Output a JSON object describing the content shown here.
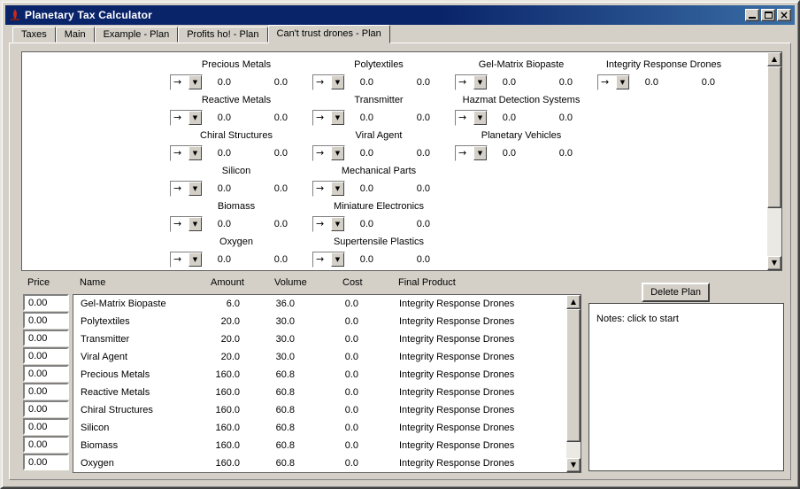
{
  "window": {
    "title": "Planetary Tax Calculator"
  },
  "tabs": [
    {
      "label": "Taxes",
      "active": false
    },
    {
      "label": "Main",
      "active": false
    },
    {
      "label": "Example - Plan",
      "active": false
    },
    {
      "label": "Profits ho! - Plan",
      "active": false
    },
    {
      "label": "Can't trust drones - Plan",
      "active": true
    }
  ],
  "icons": {
    "close": "×",
    "scroll_up": "▲",
    "scroll_down": "▼",
    "dropdown_arrow": "▼"
  },
  "plan_grid": {
    "combo_value": "→",
    "columns": [
      {
        "items": [
          {
            "label": "Precious Metals",
            "value1": "0.0",
            "value2": "0.0"
          },
          {
            "label": "Reactive Metals",
            "value1": "0.0",
            "value2": "0.0"
          },
          {
            "label": "Chiral Structures",
            "value1": "0.0",
            "value2": "0.0"
          },
          {
            "label": "Silicon",
            "value1": "0.0",
            "value2": "0.0"
          },
          {
            "label": "Biomass",
            "value1": "0.0",
            "value2": "0.0"
          },
          {
            "label": "Oxygen",
            "value1": "0.0",
            "value2": "0.0"
          }
        ]
      },
      {
        "items": [
          {
            "label": "Polytextiles",
            "value1": "0.0",
            "value2": "0.0"
          },
          {
            "label": "Transmitter",
            "value1": "0.0",
            "value2": "0.0"
          },
          {
            "label": "Viral Agent",
            "value1": "0.0",
            "value2": "0.0"
          },
          {
            "label": "Mechanical Parts",
            "value1": "0.0",
            "value2": "0.0"
          },
          {
            "label": "Miniature Electronics",
            "value1": "0.0",
            "value2": "0.0"
          },
          {
            "label": "Supertensile Plastics",
            "value1": "0.0",
            "value2": "0.0"
          }
        ]
      },
      {
        "items": [
          {
            "label": "Gel-Matrix Biopaste",
            "value1": "0.0",
            "value2": "0.0"
          },
          {
            "label": "Hazmat Detection Systems",
            "value1": "0.0",
            "value2": "0.0"
          },
          {
            "label": "Planetary Vehicles",
            "value1": "0.0",
            "value2": "0.0"
          }
        ]
      },
      {
        "items": [
          {
            "label": "Integrity Response Drones",
            "value1": "0.0",
            "value2": "0.0"
          }
        ]
      }
    ]
  },
  "table": {
    "headers": [
      "Price",
      "Name",
      "Amount",
      "Volume",
      "Cost",
      "Final Product"
    ],
    "rows": [
      {
        "price": "0.00",
        "name": "Gel-Matrix Biopaste",
        "amount": "6.0",
        "volume": "36.0",
        "cost": "0.0",
        "final_product": "Integrity Response Drones"
      },
      {
        "price": "0.00",
        "name": "Polytextiles",
        "amount": "20.0",
        "volume": "30.0",
        "cost": "0.0",
        "final_product": "Integrity Response Drones"
      },
      {
        "price": "0.00",
        "name": "Transmitter",
        "amount": "20.0",
        "volume": "30.0",
        "cost": "0.0",
        "final_product": "Integrity Response Drones"
      },
      {
        "price": "0.00",
        "name": "Viral Agent",
        "amount": "20.0",
        "volume": "30.0",
        "cost": "0.0",
        "final_product": "Integrity Response Drones"
      },
      {
        "price": "0.00",
        "name": "Precious Metals",
        "amount": "160.0",
        "volume": "60.8",
        "cost": "0.0",
        "final_product": "Integrity Response Drones"
      },
      {
        "price": "0.00",
        "name": "Reactive Metals",
        "amount": "160.0",
        "volume": "60.8",
        "cost": "0.0",
        "final_product": "Integrity Response Drones"
      },
      {
        "price": "0.00",
        "name": "Chiral Structures",
        "amount": "160.0",
        "volume": "60.8",
        "cost": "0.0",
        "final_product": "Integrity Response Drones"
      },
      {
        "price": "0.00",
        "name": "Silicon",
        "amount": "160.0",
        "volume": "60.8",
        "cost": "0.0",
        "final_product": "Integrity Response Drones"
      },
      {
        "price": "0.00",
        "name": "Biomass",
        "amount": "160.0",
        "volume": "60.8",
        "cost": "0.0",
        "final_product": "Integrity Response Drones"
      },
      {
        "price": "0.00",
        "name": "Oxygen",
        "amount": "160.0",
        "volume": "60.8",
        "cost": "0.0",
        "final_product": "Integrity Response Drones"
      }
    ]
  },
  "buttons": {
    "delete_plan": "Delete Plan"
  },
  "notes": {
    "text": "Notes: click to start"
  },
  "colors": {
    "chrome": "#d4d0c8",
    "titlebar_left": "#0a246a",
    "titlebar_right": "#3a6ea5",
    "field_bg": "#ffffff",
    "border_dark": "#606060",
    "text": "#000000"
  }
}
